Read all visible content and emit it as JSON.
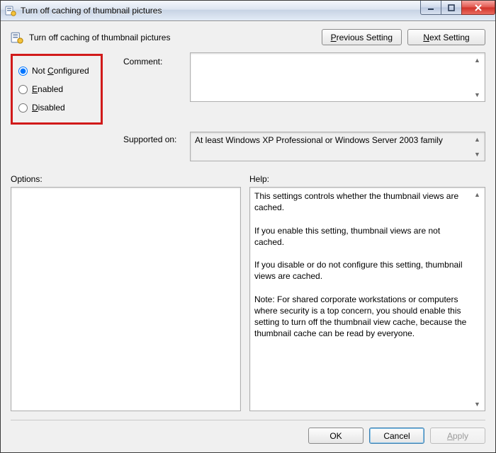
{
  "window": {
    "title": "Turn off caching of thumbnail pictures"
  },
  "header": {
    "policy_title": "Turn off caching of thumbnail pictures",
    "prev_label_pre": "P",
    "prev_label_post": "revious Setting",
    "next_label_pre": "N",
    "next_label_post": "ext Setting"
  },
  "radios": {
    "not_configured_pre": "Not ",
    "not_configured_u": "C",
    "not_configured_post": "onfigured",
    "enabled_u": "E",
    "enabled_post": "nabled",
    "disabled_u": "D",
    "disabled_post": "isabled",
    "selected": "not_configured"
  },
  "labels": {
    "comment": "Comment:",
    "supported": "Supported on:",
    "options": "Options:",
    "help": "Help:"
  },
  "fields": {
    "comment": "",
    "supported": "At least Windows XP Professional or Windows Server 2003 family"
  },
  "help_text": "This settings controls whether the thumbnail views are cached.\n\nIf you enable this setting, thumbnail views are not cached.\n\nIf you disable or do not configure this setting, thumbnail views are cached.\n\nNote: For shared corporate workstations or computers where security is a top concern, you should enable this setting to turn off the thumbnail view cache, because the thumbnail cache can be read by everyone.",
  "footer": {
    "ok": "OK",
    "cancel": "Cancel",
    "apply_u": "A",
    "apply_post": "pply"
  }
}
